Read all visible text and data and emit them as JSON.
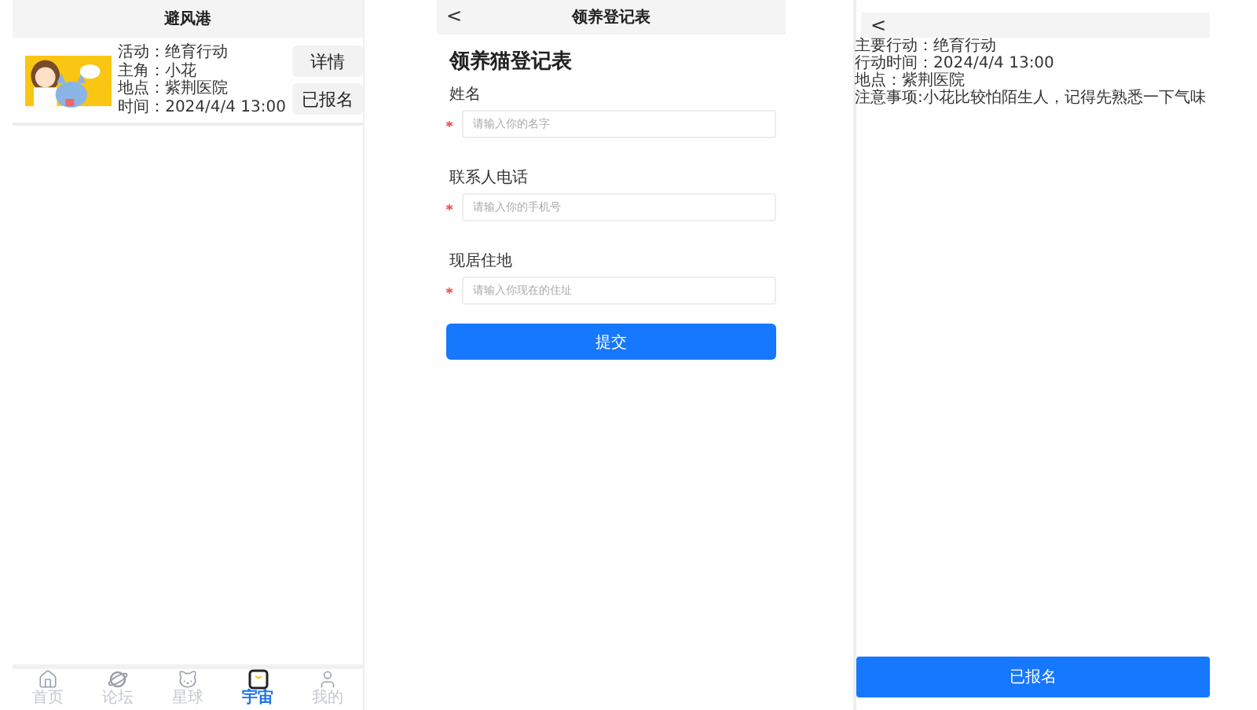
{
  "list_screen": {
    "title": "避风港",
    "cards": [
      {
        "image": {
          "kind": "picture"
        },
        "lines": [
          "活动：绝育行动",
          "主角：小花",
          "地点：紫荆医院",
          "时间：2024/4/4 13:00"
        ],
        "buttons": [
          "详情",
          "已报名"
        ]
      }
    ],
    "tab_bar": [
      {
        "label": "首页",
        "selected": false
      },
      {
        "label": "论坛",
        "selected": false
      },
      {
        "label": "星球",
        "selected": false
      },
      {
        "label": "宇宙",
        "selected": true
      },
      {
        "label": "我的",
        "selected": false
      }
    ]
  },
  "form_screen": {
    "back": "<",
    "title": "领养登记表",
    "heading": "领养猫登记表",
    "fields": [
      {
        "label": "姓名",
        "required": true,
        "placeholder": "请输入你的名字"
      },
      {
        "label": "联系人电话",
        "required": true,
        "placeholder": "请输入你的手机号"
      },
      {
        "label": "现居住地",
        "required": true,
        "placeholder": "请输入你现在的住址"
      }
    ],
    "submit": "提交"
  },
  "detail_screen": {
    "back": "<",
    "lines": [
      "主要行动：绝育行动",
      "行动时间：2024/4/4 13:00",
      "地点：紫荆医院",
      "注意事项:小花比较怕陌生人，记得先熟悉一下气味"
    ],
    "button": "已报名"
  }
}
